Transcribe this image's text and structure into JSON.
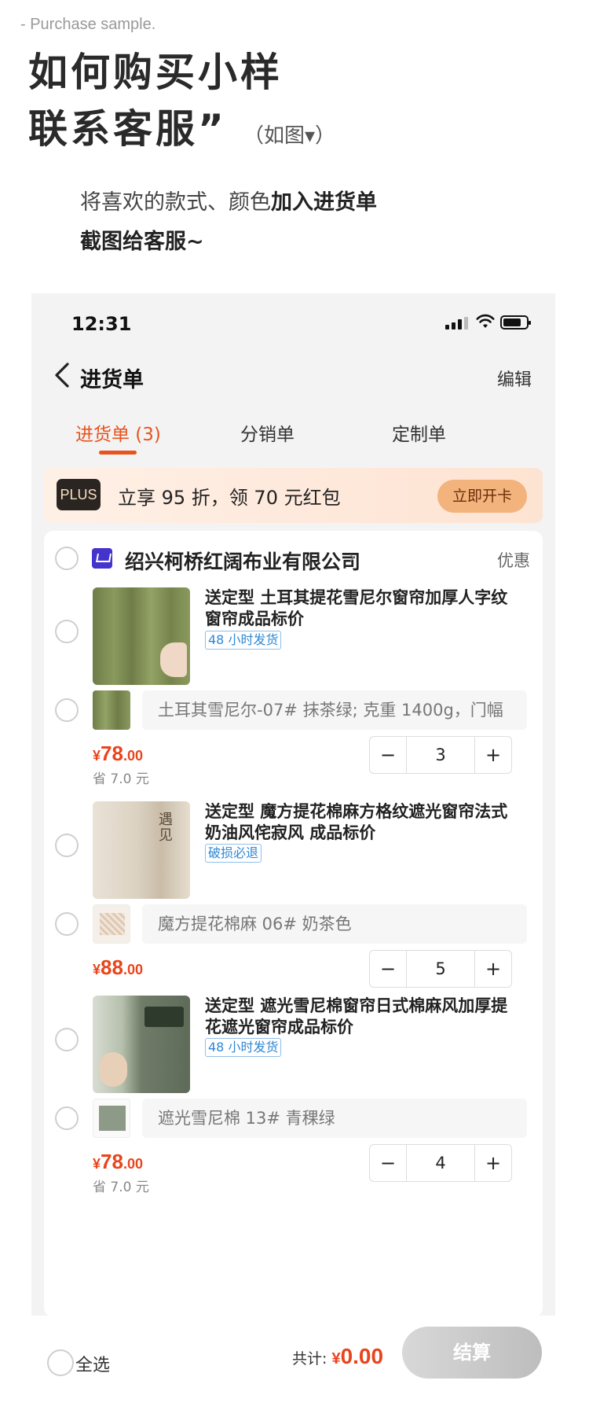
{
  "header": {
    "tag": "- Purchase sample.",
    "title_line1": "如何购买小样",
    "title_line2": "联系客服”",
    "hint": "（如图▾）",
    "intro_line1_a": "将喜欢的款式、颜色",
    "intro_line1_b": "加入进货单",
    "intro_line2": "截图给客服~"
  },
  "status_bar": {
    "time": "12:31"
  },
  "nav": {
    "back_icon": "chevron-left-icon",
    "title": "进货单",
    "edit": "编辑"
  },
  "tabs": [
    {
      "label": "进货单 (3)",
      "active": true
    },
    {
      "label": "分销单",
      "active": false
    },
    {
      "label": "定制单",
      "active": false
    }
  ],
  "plus_banner": {
    "badge": "PLUS",
    "text": "立享 95 折，领 70 元红包",
    "button": "立即开卡"
  },
  "shop": {
    "name": "绍兴柯桥红阔布业有限公司",
    "discount": "优惠"
  },
  "items": [
    {
      "title": "送定型 土耳其提花雪尼尔窗帘加厚人字纹窗帘成品标价",
      "tag": "48 小时发货",
      "sku": "土耳其雪尼尔-07# 抹茶绿; 克重 1400g，门幅",
      "currency": "¥",
      "price_main": "78",
      "price_decimal": ".00",
      "save": "省 7.0 元",
      "qty": "3"
    },
    {
      "title": "送定型 魔方提花棉麻方格纹遮光窗帘法式奶油风侘寂风 成品标价",
      "tag": "破损必退",
      "sku": "魔方提花棉麻 06# 奶茶色",
      "currency": "¥",
      "price_main": "88",
      "price_decimal": ".00",
      "save": "",
      "qty": "5"
    },
    {
      "title": "送定型 遮光雪尼棉窗帘日式棉麻风加厚提花遮光窗帘成品标价",
      "tag": "48 小时发货",
      "sku": "遮光雪尼棉 13# 青稞绿",
      "currency": "¥",
      "price_main": "78",
      "price_decimal": ".00",
      "save": "省 7.0 元",
      "qty": "4"
    }
  ],
  "bottom_bar": {
    "select_all": "全选",
    "total_label": "共计: ",
    "currency": "¥",
    "total": "0.00",
    "checkout": "结算"
  },
  "icons": {
    "minus": "−",
    "plus": "+",
    "chevron": "›"
  },
  "colors": {
    "accent": "#e8531e",
    "price": "#e8451c",
    "tag_blue": "#2f88d4"
  }
}
